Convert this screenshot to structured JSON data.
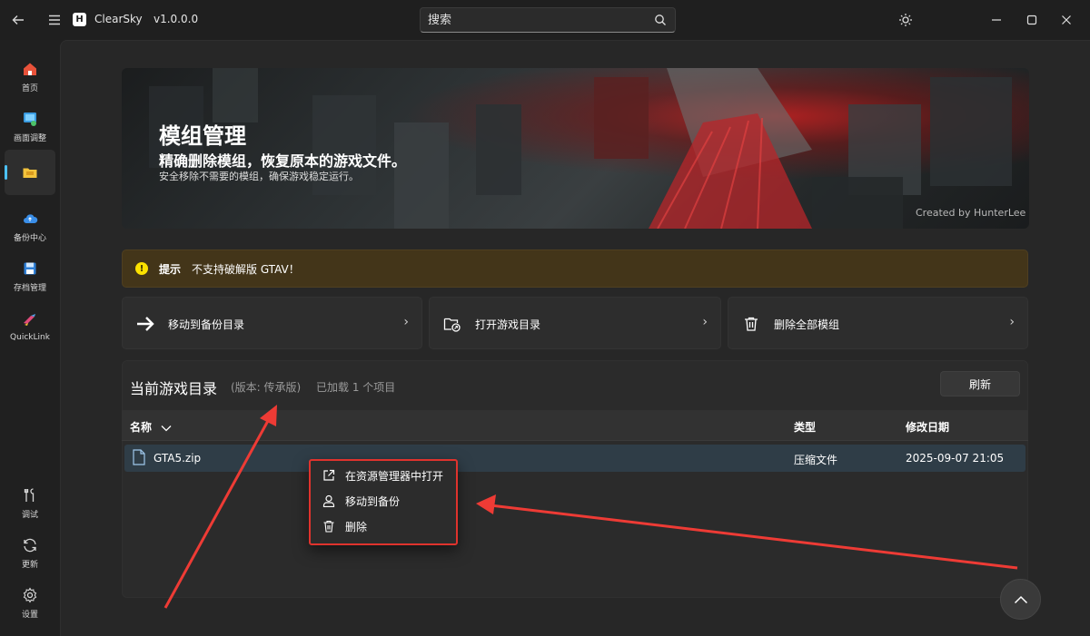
{
  "titlebar": {
    "app_name": "ClearSky",
    "version": "v1.0.0.0",
    "search_placeholder": "搜索"
  },
  "sidebar": {
    "items": [
      {
        "label": "首页",
        "icon": "home-icon"
      },
      {
        "label": "画面调整",
        "icon": "display-adjust-icon"
      },
      {
        "label": "",
        "icon": "folder-icon",
        "active": true
      },
      {
        "label": "备份中心",
        "icon": "cloud-backup-icon"
      },
      {
        "label": "存档管理",
        "icon": "save-icon"
      },
      {
        "label": "QuickLink",
        "icon": "quicklink-icon"
      }
    ],
    "bottom_items": [
      {
        "label": "调试",
        "icon": "tools-icon"
      },
      {
        "label": "更新",
        "icon": "refresh-icon"
      },
      {
        "label": "设置",
        "icon": "gear-icon"
      }
    ]
  },
  "banner": {
    "title": "模组管理",
    "subtitle": "精确删除模组，恢复原本的游戏文件。",
    "description": "安全移除不需要的模组，确保游戏稳定运行。",
    "credit": "Created by HunterLee"
  },
  "warning": {
    "title": "提示",
    "message": "不支持破解版 GTAV！"
  },
  "actions": [
    {
      "label": "移动到备份目录",
      "icon": "arrow-right-icon"
    },
    {
      "label": "打开游戏目录",
      "icon": "folder-open-icon"
    },
    {
      "label": "删除全部模组",
      "icon": "trash-icon"
    }
  ],
  "directory": {
    "title": "当前游戏目录",
    "version": "(版本: 传承版)",
    "count": "已加载 1 个项目",
    "refresh_label": "刷新",
    "columns": {
      "name": "名称",
      "type": "类型",
      "modified": "修改日期"
    },
    "rows": [
      {
        "name": "GTA5.zip",
        "type": "压缩文件",
        "modified": "2025-09-07 21:05"
      }
    ]
  },
  "context_menu": {
    "items": [
      {
        "label": "在资源管理器中打开",
        "icon": "external-link-icon"
      },
      {
        "label": "移动到备份",
        "icon": "user-icon"
      },
      {
        "label": "删除",
        "icon": "trash-icon"
      }
    ]
  },
  "colors": {
    "accent": "#4cc2ff",
    "warning_bg": "#433519",
    "highlight_red": "#e0332d",
    "selected_row": "#2f3d47"
  }
}
